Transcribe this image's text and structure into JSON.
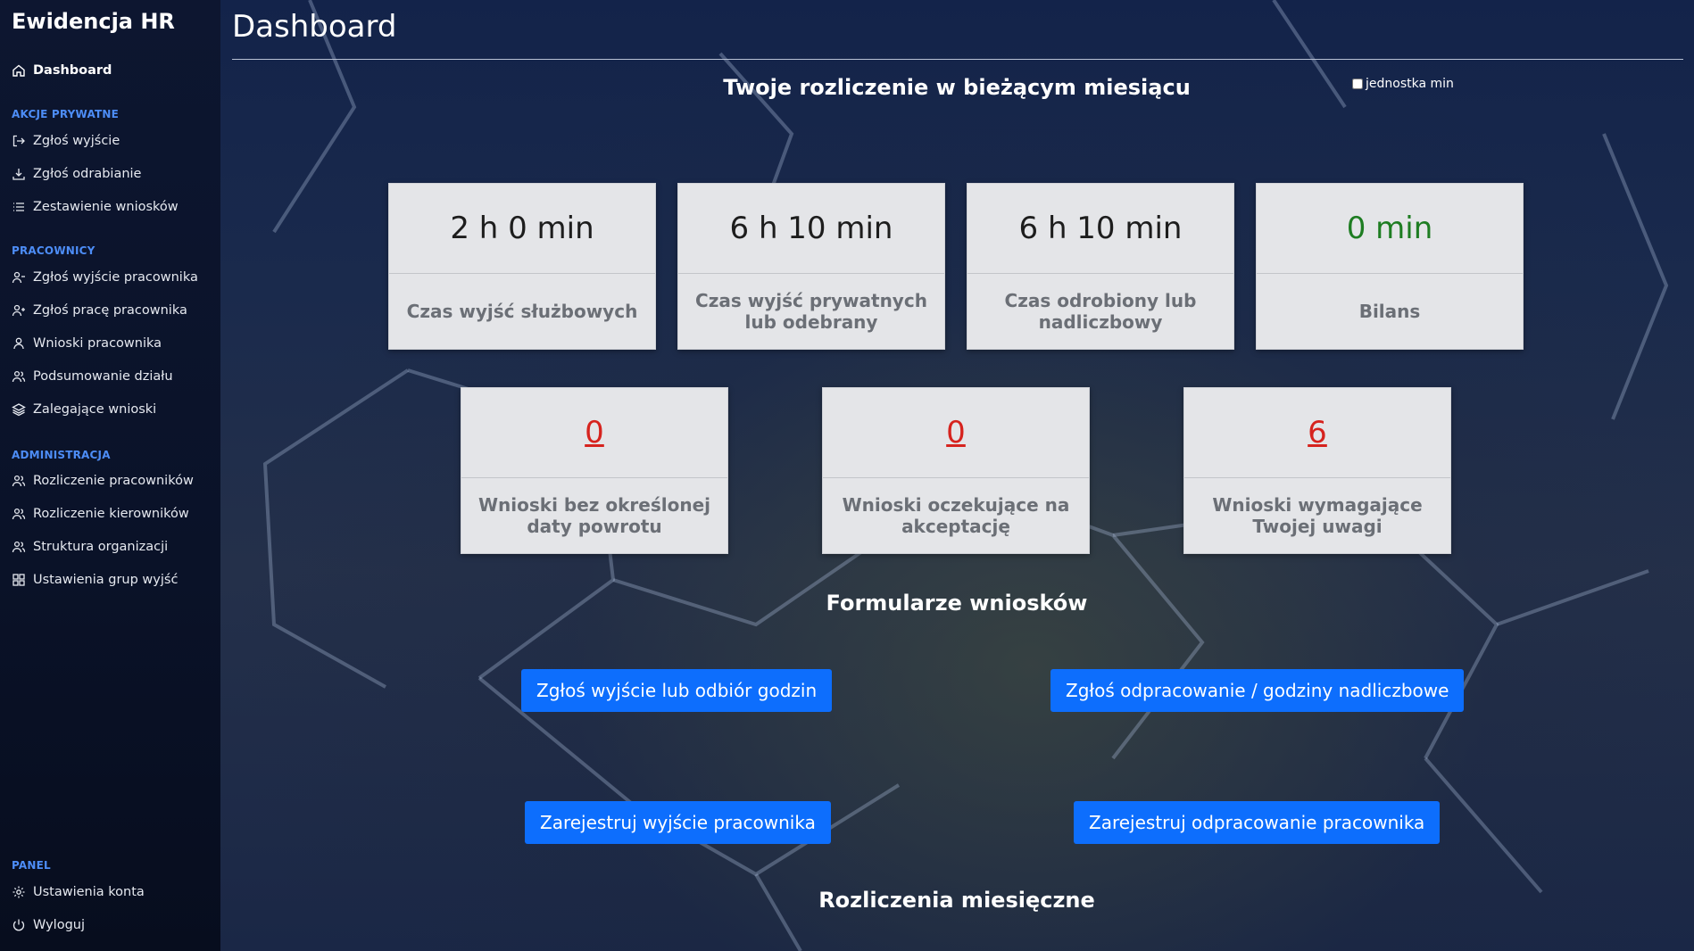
{
  "sidebar": {
    "brand": "Ewidencja HR",
    "dashboard": "Dashboard",
    "sections": {
      "private": "AKCJE PRYWATNE",
      "employees": "PRACOWNICY",
      "admin": "ADMINISTRACJA",
      "panel": "PANEL"
    },
    "private_items": [
      "Zgłoś wyjście",
      "Zgłoś odrabianie",
      "Zestawienie wniosków"
    ],
    "employee_items": [
      "Zgłoś wyjście pracownika",
      "Zgłoś pracę pracownika",
      "Wnioski pracownika",
      "Podsumowanie działu",
      "Zalegające wnioski"
    ],
    "admin_items": [
      "Rozliczenie pracowników",
      "Rozliczenie kierowników",
      "Struktura organizacji",
      "Ustawienia grup wyjść"
    ],
    "panel_items": [
      "Ustawienia konta",
      "Wyloguj"
    ]
  },
  "main": {
    "title": "Dashboard",
    "summary_heading": "Twoje rozliczenie w bieżącym miesiącu",
    "unit_toggle_label": "jednostka min",
    "unit_toggle_checked": false,
    "summary_cards": [
      {
        "value": "2 h 0 min",
        "label": "Czas wyjść służbowych"
      },
      {
        "value": "6 h 10 min",
        "label": "Czas wyjść prywatnych lub odebrany"
      },
      {
        "value": "6 h 10 min",
        "label": "Czas odrobiony lub nadliczbowy"
      },
      {
        "value": "0 min",
        "label": "Bilans",
        "value_color": "#1e7d22"
      }
    ],
    "request_cards": [
      {
        "value": "0",
        "label": "Wnioski bez określonej daty powrotu"
      },
      {
        "value": "0",
        "label": "Wnioski oczekujące na akceptację"
      },
      {
        "value": "6",
        "label": "Wnioski wymagające Twojej uwagi"
      }
    ],
    "forms_heading": "Formularze wniosków",
    "buttons": {
      "report_exit": "Zgłoś wyjście lub odbiór godzin",
      "report_overtime": "Zgłoś odpracowanie / godziny nadliczbowe",
      "register_employee_exit": "Zarejestruj wyjście pracownika",
      "register_employee_work": "Zarejestruj odpracowanie pracownika"
    },
    "monthly_heading": "Rozliczenia miesięczne"
  },
  "colors": {
    "accent": "#0d6efd",
    "section_label": "#4d8df7",
    "link_red": "#d6231e",
    "balance_green": "#1e7d22"
  }
}
